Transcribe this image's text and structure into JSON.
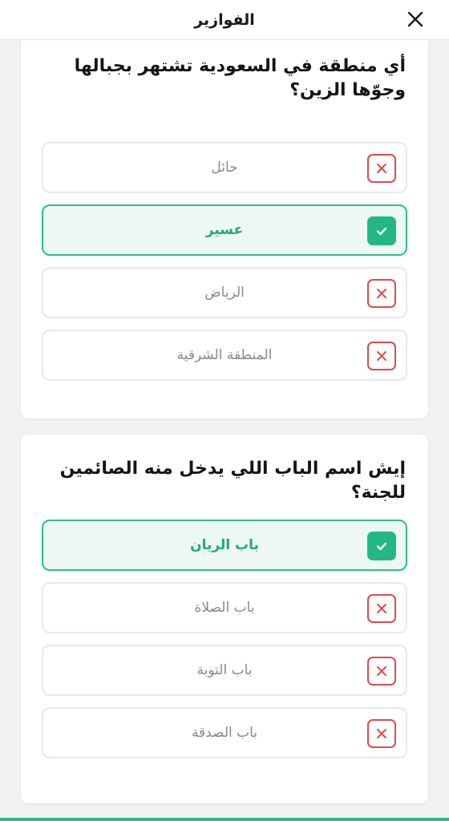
{
  "header": {
    "title": "الفوازير",
    "close_icon": "close-icon"
  },
  "questions": [
    {
      "text": "أي منطقة في السعودية تشتهر بجبالها وجوّها الزين؟",
      "options": [
        {
          "label": "حائل",
          "state": "wrong"
        },
        {
          "label": "عسير",
          "state": "correct"
        },
        {
          "label": "الرياض",
          "state": "wrong"
        },
        {
          "label": "المنطقة الشرقية",
          "state": "wrong"
        }
      ]
    },
    {
      "text": "إيش اسم الباب اللي يدخل منه الصائمين للجنة؟",
      "options": [
        {
          "label": "باب الريان",
          "state": "correct"
        },
        {
          "label": "باب الصلاة",
          "state": "wrong"
        },
        {
          "label": "باب التوبة",
          "state": "wrong"
        },
        {
          "label": "باب الصدقة",
          "state": "wrong"
        }
      ]
    }
  ],
  "colors": {
    "correct_border": "#2cc08d",
    "correct_bg": "#edf7f3",
    "correct_text": "#1faa77",
    "wrong_mark": "#e04b4b",
    "accent_bar": "#27b985"
  }
}
